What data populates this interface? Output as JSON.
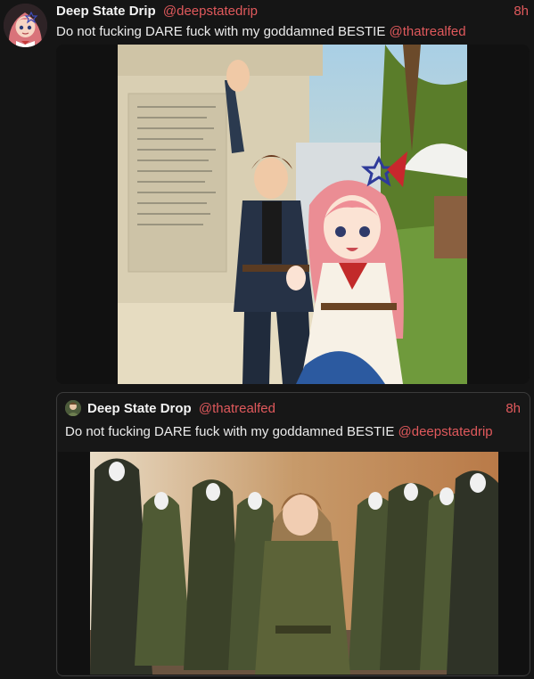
{
  "post": {
    "display_name": "Deep State Drip",
    "handle": "@deepstatedrip",
    "time": "8h",
    "text": "Do not fucking DARE fuck with my goddamned BESTIE ",
    "mention": "@thatrealfed",
    "avatar_icon": "anime-girl-avatar-icon",
    "image_icon": "anime-illustration-image"
  },
  "quote": {
    "display_name": "Deep State Drop",
    "handle": "@thatrealfed",
    "time": "8h",
    "text": "Do not fucking DARE fuck with my goddamned BESTIE ",
    "mention": "@deepstatedrip",
    "avatar_icon": "user-avatar-icon",
    "image_icon": "group-photo-image"
  },
  "colors": {
    "background": "#151515",
    "accent": "#e0595c",
    "border": "#3b3b3b"
  }
}
